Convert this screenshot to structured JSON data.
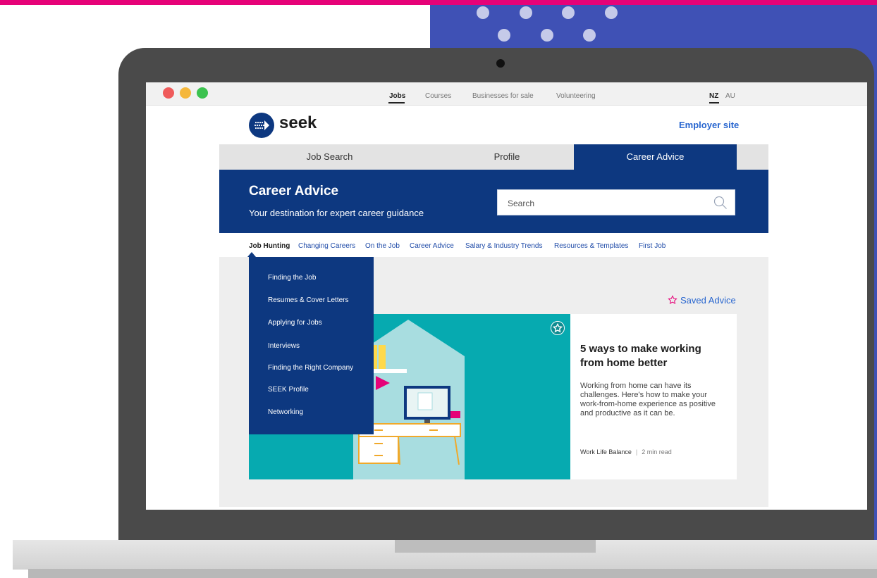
{
  "browser": {
    "top_nav": [
      "Jobs",
      "Courses",
      "Businesses for sale",
      "Volunteering"
    ],
    "regions": [
      "NZ",
      "AU"
    ]
  },
  "site": {
    "logo_text": "seek",
    "employer_link": "Employer site"
  },
  "tabs": [
    "Job Search",
    "Profile",
    "Career Advice"
  ],
  "banner": {
    "title": "Career Advice",
    "subtitle": "Your destination for expert career guidance",
    "search_placeholder": "Search"
  },
  "subnav": [
    "Job Hunting",
    "Changing Careers",
    "On the Job",
    "Career Advice",
    "Salary & Industry Trends",
    "Resources & Templates",
    "First Job"
  ],
  "dropdown": [
    "Finding the Job",
    "Resumes & Cover Letters",
    "Applying for Jobs",
    "Interviews",
    "Finding the Right Company",
    "SEEK Profile",
    "Networking"
  ],
  "saved_advice": "Saved Advice",
  "article": {
    "title": "5 ways to make working from home better",
    "description": "Working from home can have its challenges. Here's how to make your work-from-home experience as positive and productive as it can be.",
    "category": "Work Life Balance",
    "separator": "|",
    "read_time": "2 min read"
  },
  "colors": {
    "brand_navy": "#0d3880",
    "link_blue": "#2765cf",
    "accent_pink": "#e60278",
    "panel_blue": "#3f51b5"
  }
}
